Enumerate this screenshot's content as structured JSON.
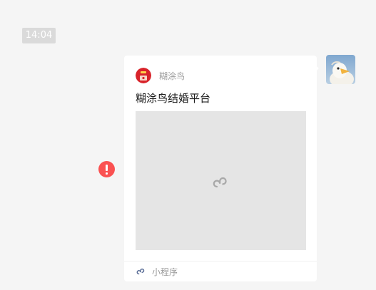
{
  "chat": {
    "timestamp": "14:04"
  },
  "message": {
    "sender_avatar": "bird-avatar-icon",
    "status": "send-failed",
    "status_icon": "exclamation-icon",
    "card": {
      "app_logo": "app-logo-icon",
      "app_name": "糊涂鸟",
      "title": "糊涂鸟结婚平台",
      "preview_icon": "mini-program-icon",
      "footer_label": "小程序"
    }
  },
  "colors": {
    "background": "#f5f5f5",
    "card": "#ffffff",
    "preview_placeholder": "#e5e5e5",
    "error": "#fa5151",
    "mini_program_accent": "#576b95"
  }
}
